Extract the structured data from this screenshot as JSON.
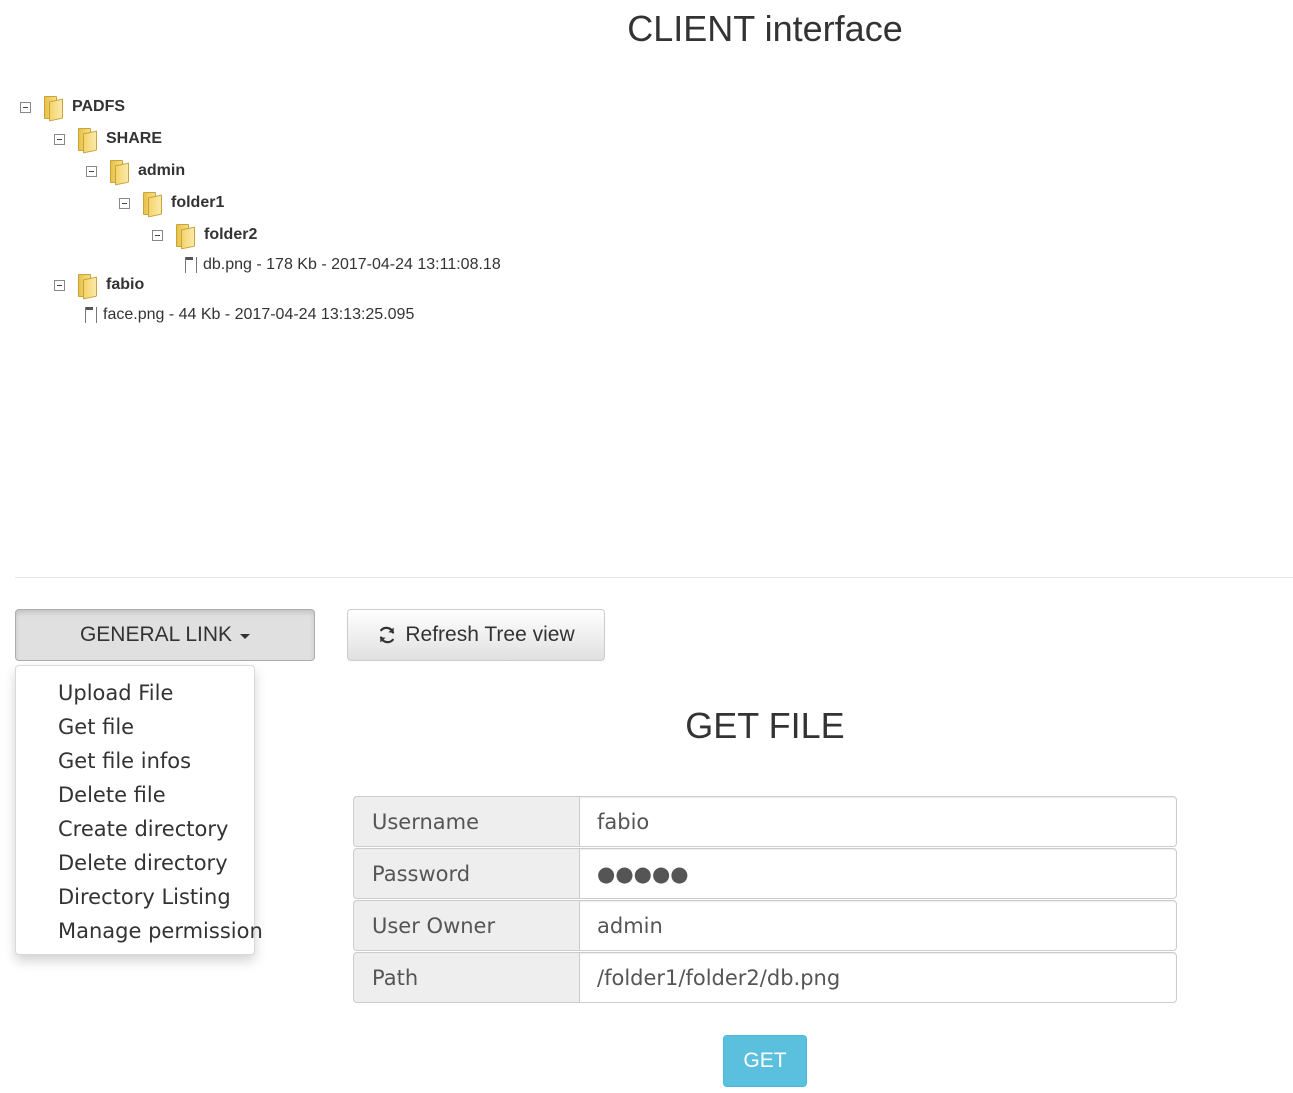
{
  "header": {
    "title": "CLIENT interface"
  },
  "tree": {
    "root": "PADFS",
    "share": "SHARE",
    "admin": "admin",
    "folder1": "folder1",
    "folder2": "folder2",
    "file_db": "db.png - 178 Kb - 2017-04-24 13:11:08.18",
    "fabio": "fabio",
    "file_face": "face.png - 44 Kb - 2017-04-24 13:13:25.095"
  },
  "toolbar": {
    "general_link_label": "GENERAL LINK",
    "refresh_label": "Refresh Tree view"
  },
  "menu": {
    "items": [
      "Upload File",
      "Get file",
      "Get file infos",
      "Delete file",
      "Create directory",
      "Delete directory",
      "Directory Listing",
      "Manage permission"
    ]
  },
  "form": {
    "title": "GET FILE",
    "username_label": "Username",
    "username_value": "fabio",
    "password_label": "Password",
    "password_value": "●●●●●",
    "owner_label": "User Owner",
    "owner_value": "admin",
    "path_label": "Path",
    "path_value": "/folder1/folder2/db.png",
    "submit_label": "GET"
  },
  "colors": {
    "accent": "#5bc0de",
    "folder": "#f3d46c"
  }
}
